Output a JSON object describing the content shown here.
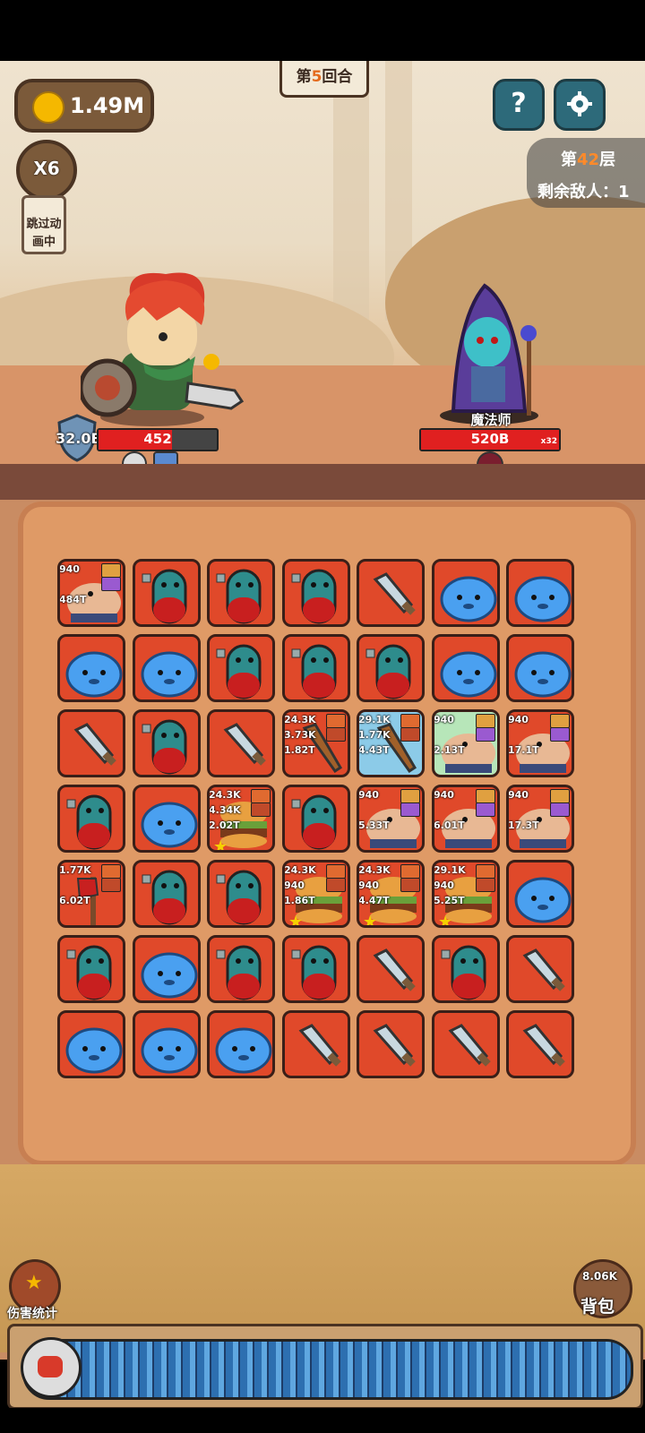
{
  "hud": {
    "coins": "1.49M",
    "round_prefix": "第",
    "round_num": "5",
    "round_suffix": "回合",
    "speed_label": "X6",
    "skip_label_line1": "跳过动",
    "skip_label_line2": "画中",
    "help_icon": "question-icon",
    "settings_icon": "gear-icon",
    "floor_prefix": "第",
    "floor_num": "42",
    "floor_suffix": "层",
    "enemies_left_label": "剩余敌人：1"
  },
  "player": {
    "shield": "32.0B",
    "hp": "452",
    "hp_fraction": 0.62
  },
  "enemy": {
    "name": "魔法师",
    "hp": "520B",
    "multiplier": "x32",
    "hp_fraction": 1.0
  },
  "board": {
    "rows": [
      [
        {
          "kind": "brawler",
          "top": "940",
          "bottom": "484T",
          "badge": "purple"
        },
        {
          "kind": "capsule"
        },
        {
          "kind": "capsule"
        },
        {
          "kind": "capsule"
        },
        {
          "kind": "sword"
        },
        {
          "kind": "slime"
        },
        {
          "kind": "slime"
        }
      ],
      [
        {
          "kind": "slime"
        },
        {
          "kind": "slime"
        },
        {
          "kind": "capsule"
        },
        {
          "kind": "capsule"
        },
        {
          "kind": "capsule"
        },
        {
          "kind": "slime"
        },
        {
          "kind": "slime"
        }
      ],
      [
        {
          "kind": "sword"
        },
        {
          "kind": "capsule"
        },
        {
          "kind": "sword"
        },
        {
          "kind": "club",
          "top": "24.3K",
          "mid": "3.73K",
          "bottom": "1.82T",
          "badge": "orange"
        },
        {
          "kind": "club",
          "top": "29.1K",
          "mid": "1.77K",
          "bottom": "4.43T",
          "badge": "orange",
          "highlight": "blue"
        },
        {
          "kind": "brawler",
          "top": "940",
          "bottom": "2.13T",
          "badge": "purple",
          "highlight": "green"
        },
        {
          "kind": "brawler",
          "top": "940",
          "bottom": "17.1T",
          "badge": "purple"
        }
      ],
      [
        {
          "kind": "capsule"
        },
        {
          "kind": "slime"
        },
        {
          "kind": "burger",
          "top": "24.3K",
          "mid": "4.34K",
          "bottom": "2.02T",
          "badge": "orange"
        },
        {
          "kind": "capsule"
        },
        {
          "kind": "brawler",
          "top": "940",
          "bottom": "5.33T",
          "badge": "purple"
        },
        {
          "kind": "brawler",
          "top": "940",
          "bottom": "6.01T",
          "badge": "purple"
        },
        {
          "kind": "brawler",
          "top": "940",
          "bottom": "17.3T",
          "badge": "purple"
        }
      ],
      [
        {
          "kind": "axe",
          "top": "1.77K",
          "bottom": "6.02T",
          "badge": "orange"
        },
        {
          "kind": "capsule"
        },
        {
          "kind": "capsule"
        },
        {
          "kind": "burger",
          "top": "24.3K",
          "mid": "940",
          "bottom": "1.86T",
          "badge": "orange"
        },
        {
          "kind": "burger",
          "top": "24.3K",
          "mid": "940",
          "bottom": "4.47T",
          "badge": "orange"
        },
        {
          "kind": "burger",
          "top": "29.1K",
          "mid": "940",
          "bottom": "5.25T",
          "badge": "orange"
        },
        {
          "kind": "slime"
        }
      ],
      [
        {
          "kind": "capsule"
        },
        {
          "kind": "slime"
        },
        {
          "kind": "capsule"
        },
        {
          "kind": "capsule"
        },
        {
          "kind": "sword"
        },
        {
          "kind": "capsule"
        },
        {
          "kind": "sword"
        }
      ],
      [
        {
          "kind": "slime"
        },
        {
          "kind": "slime"
        },
        {
          "kind": "slime"
        },
        {
          "kind": "sword"
        },
        {
          "kind": "sword"
        },
        {
          "kind": "sword"
        },
        {
          "kind": "sword"
        }
      ]
    ]
  },
  "bottom": {
    "damage_stats_label": "伤害统计",
    "backpack_label": "背包",
    "backpack_count": "8.06K"
  }
}
